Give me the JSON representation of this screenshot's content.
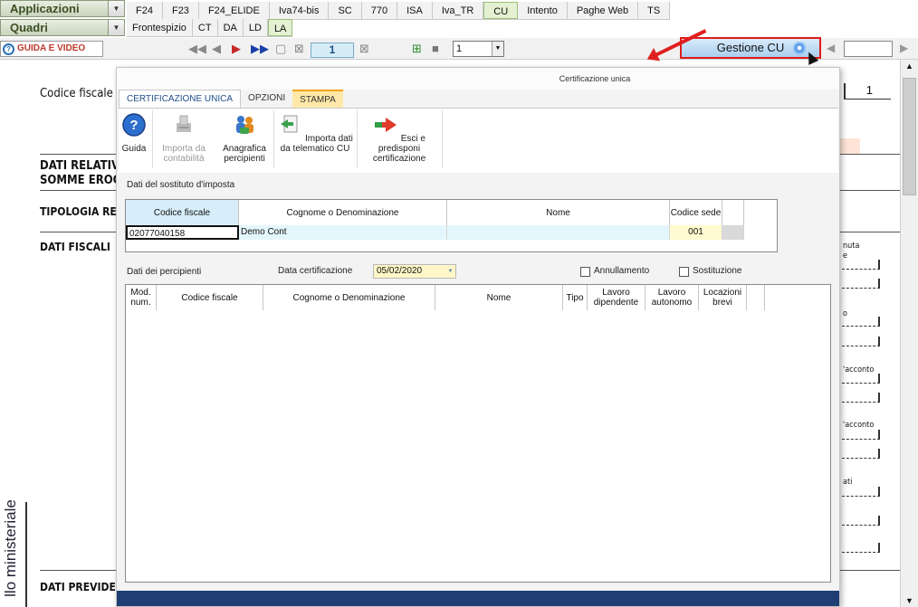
{
  "menus": {
    "applicazioni": "Applicazioni",
    "quadri": "Quadri"
  },
  "apps_tabs": [
    "F24",
    "F23",
    "F24_ELIDE",
    "Iva74-bis",
    "SC",
    "770",
    "ISA",
    "Iva_TR",
    "CU",
    "Intento",
    "Paghe Web",
    "TS"
  ],
  "apps_active": "CU",
  "quadri_tabs": [
    "Frontespizio",
    "CT",
    "DA",
    "LD",
    "LA"
  ],
  "quadri_active": "LA",
  "toolbar": {
    "guida_label": "GUIDA E VIDEO",
    "page_value": "1",
    "combo_value": "1",
    "gestione_label": "Gestione CU"
  },
  "background": {
    "codice_fiscale": "Codice fiscale de",
    "right_value": "1",
    "dati_relativi": "DATI RELATIVI A",
    "somme_erog": "SOMME EROG",
    "tipologia": "TIPOLOGIA RED",
    "dati_fiscali": "DATI FISCALI",
    "dati_previdenziali": "DATI PREVIDENZ",
    "vertical": "llo ministeriale",
    "right_labels": [
      "nuta",
      "e",
      "o",
      "'acconto",
      "'acconto",
      "ati"
    ]
  },
  "dialog": {
    "title": "Certificazione unica",
    "tabs": [
      "CERTIFICAZIONE UNICA",
      "OPZIONI",
      "STAMPA"
    ],
    "ribbon": [
      {
        "label": "Guida",
        "icon": "help-icon",
        "enabled": true
      },
      {
        "label": "Importa da contabilità",
        "icon": "import-accounting-icon",
        "enabled": false
      },
      {
        "label": "Anagrafica percipienti",
        "icon": "people-icon",
        "enabled": true
      },
      {
        "label": "Importa dati da telematico CU",
        "icon": "import-telematic-icon",
        "enabled": true
      },
      {
        "label": "Esci e predisponi certificazione",
        "icon": "exit-arrow-icon",
        "enabled": true
      }
    ],
    "sostituto_label": "Dati del sostituto d'imposta",
    "sostituto_headers": [
      "Codice fiscale",
      "Cognome o Denominazione",
      "Nome",
      "Codice sede"
    ],
    "sostituto_row": {
      "codice_fiscale": "02077040158",
      "cognome": "Demo Cont",
      "nome": "",
      "codice_sede": "001"
    },
    "percipienti_label": "Dati dei percipienti",
    "data_cert_label": "Data certificazione",
    "data_cert_value": "05/02/2020",
    "annullamento_label": "Annullamento",
    "sostituzione_label": "Sostituzione",
    "percipienti_headers": [
      "Mod. num.",
      "Codice fiscale",
      "Cognome o Denominazione",
      "Nome",
      "Tipo",
      "Lavoro dipendente",
      "Lavoro autonomo",
      "Locazioni brevi"
    ]
  }
}
